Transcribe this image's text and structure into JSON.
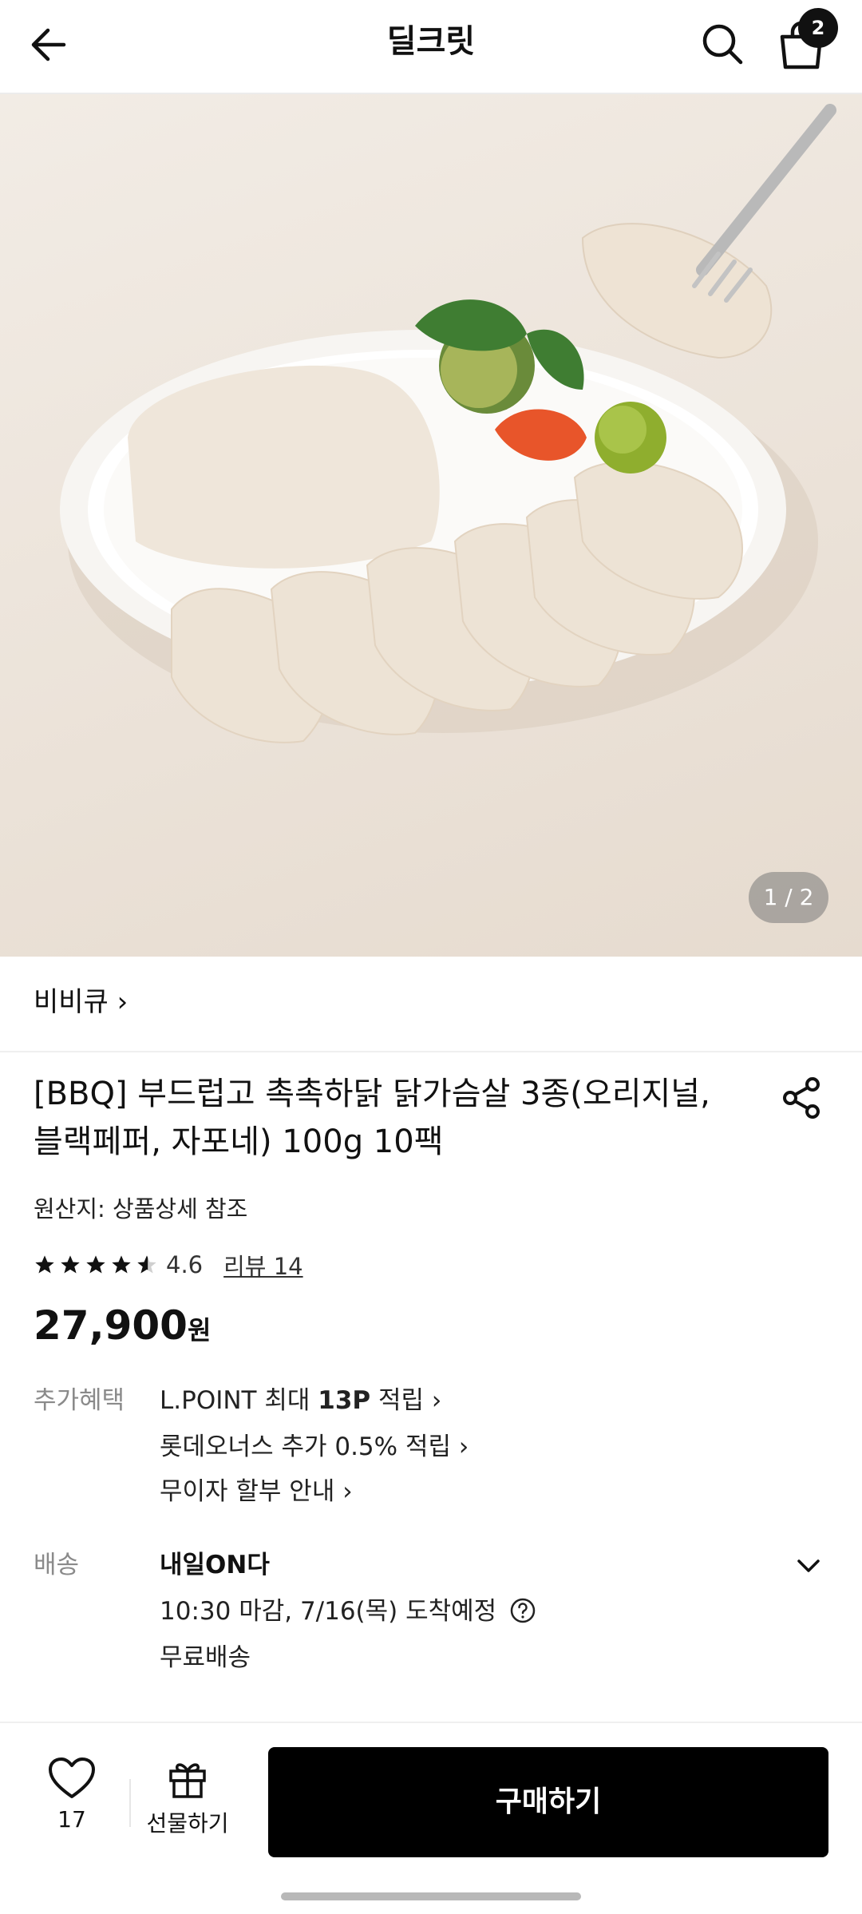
{
  "header": {
    "title": "딜크릿",
    "cart_count": "2"
  },
  "gallery": {
    "counter": "1 / 2"
  },
  "brand": {
    "name": "비비큐 ›"
  },
  "product": {
    "title": "[BBQ] 부드럽고 촉촉하닭 닭가슴살 3종(오리지널, 블랙페퍼, 자포네) 100g 10팩",
    "origin": "원산지: 상품상세 참조",
    "rating": "4.6",
    "rating_fraction": 0.92,
    "review_link": "리뷰 14",
    "price": "27,900",
    "price_unit": "원"
  },
  "benefits": {
    "label": "추가혜택",
    "lpoint_prefix": "L.POINT 최대 ",
    "lpoint_bold": "13P",
    "lpoint_suffix": " 적립 ›",
    "lotte_onus": "롯데오너스 추가 0.5% 적립 ›",
    "installment": "무이자 할부 안내 ›"
  },
  "delivery": {
    "label": "배송",
    "title": "내일ON다",
    "deadline": "10:30 마감, 7/16(목) 도착예정",
    "fee": "무료배송"
  },
  "bottom_bar": {
    "like_count": "17",
    "gift_label": "선물하기",
    "buy_label": "구매하기"
  },
  "icons": {
    "back": "back-arrow-icon",
    "search": "search-icon",
    "cart": "shopping-bag-icon",
    "share": "share-icon",
    "heart": "heart-icon",
    "gift": "gift-icon",
    "chevron": "chevron-down-icon",
    "help": "question-circle-icon"
  }
}
